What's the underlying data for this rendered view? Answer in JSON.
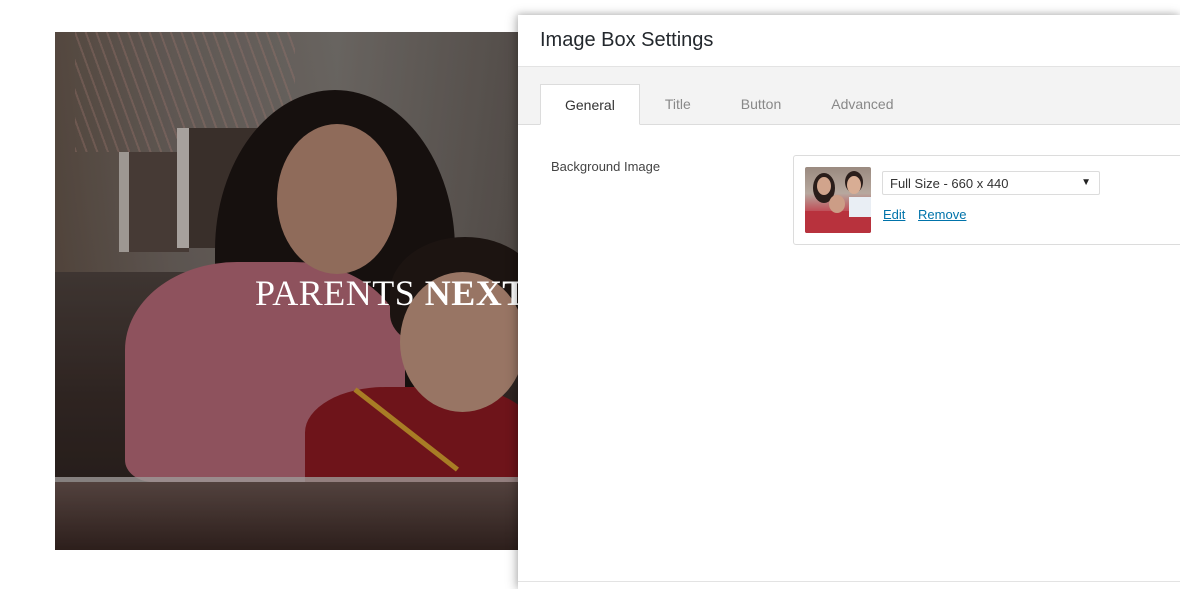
{
  "preview": {
    "headline_regular": "PARENTS",
    "headline_bold": "NEXT"
  },
  "panel": {
    "title": "Image Box Settings",
    "tabs": [
      {
        "label": "General",
        "active": true
      },
      {
        "label": "Title",
        "active": false
      },
      {
        "label": "Button",
        "active": false
      },
      {
        "label": "Advanced",
        "active": false
      }
    ],
    "fields": {
      "background_image": {
        "label": "Background Image",
        "size_select": {
          "value": "Full Size - 660 x 440"
        },
        "edit_link": "Edit",
        "remove_link": "Remove"
      }
    }
  },
  "colors": {
    "link": "#0073aa",
    "tab_bar_bg": "#f3f3f3"
  }
}
